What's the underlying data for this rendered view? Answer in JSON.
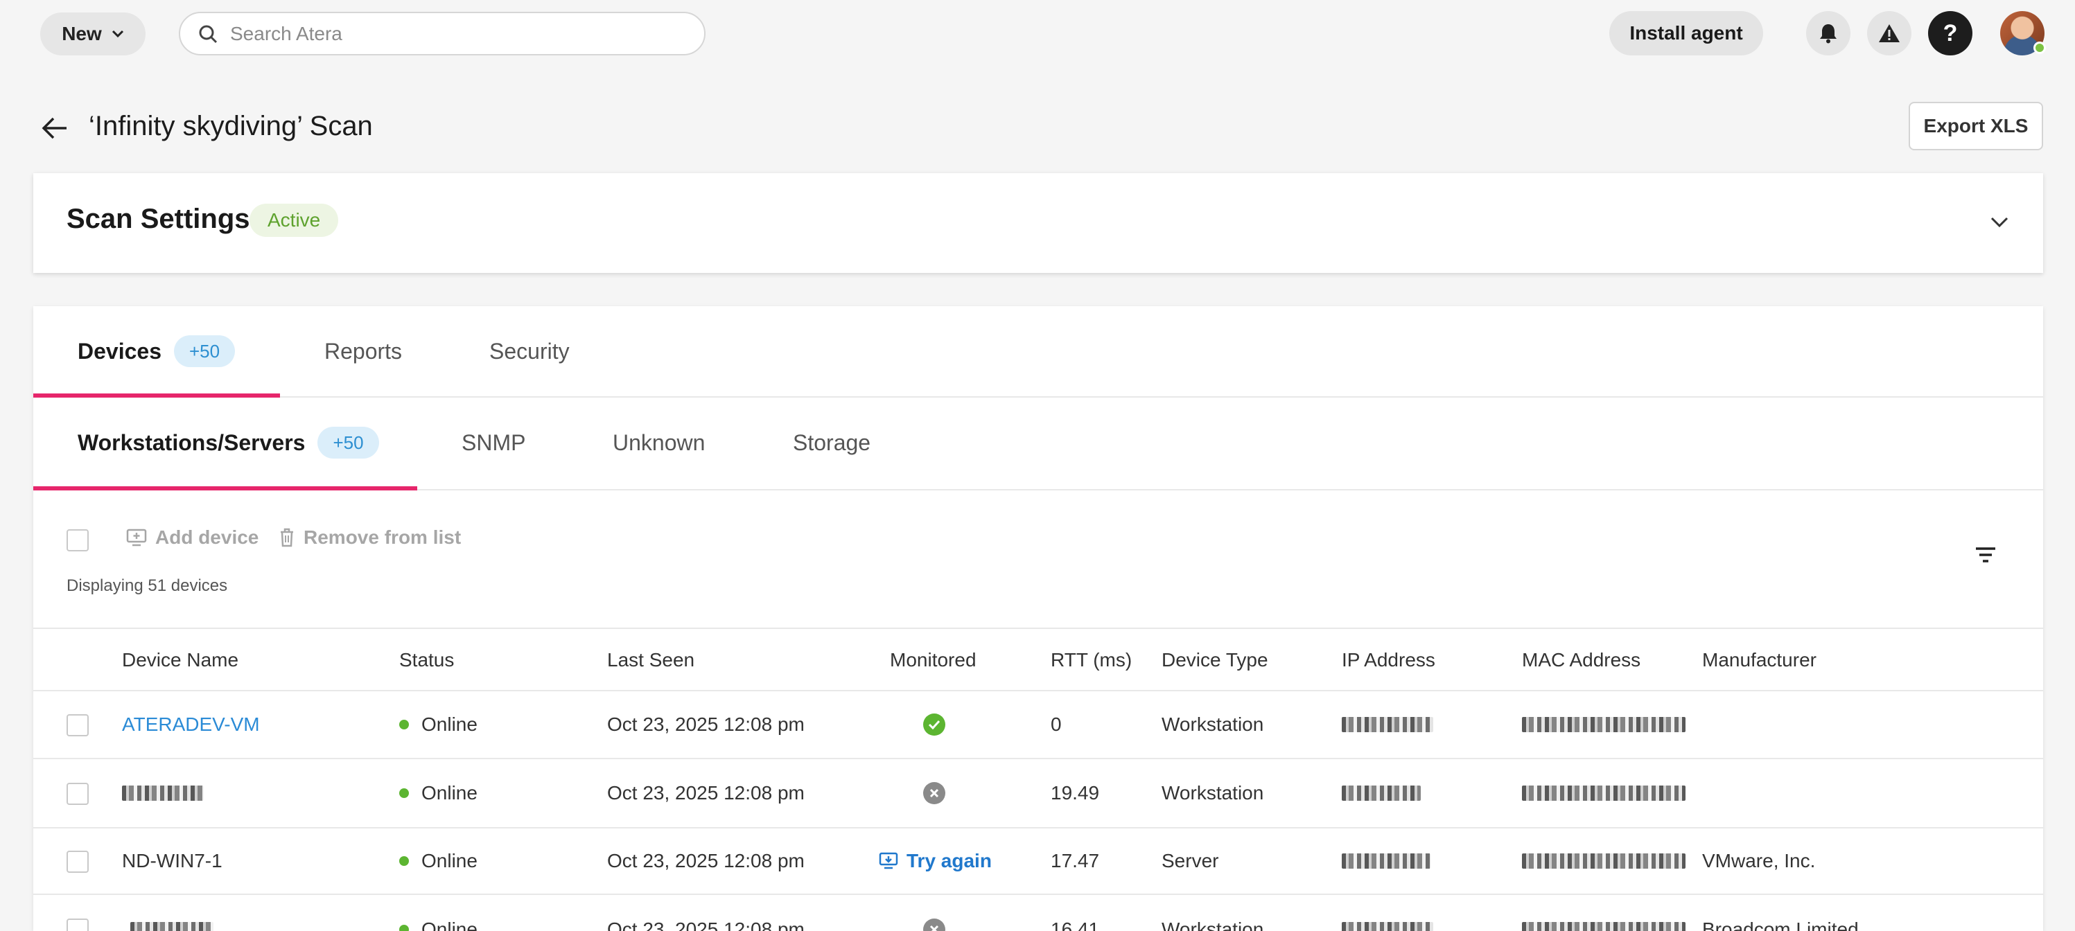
{
  "topbar": {
    "new_label": "New",
    "search_placeholder": "Search Atera",
    "install_agent_label": "Install agent",
    "help_label": "?"
  },
  "header": {
    "title": "‘Infinity skydiving’ Scan",
    "export_label": "Export XLS"
  },
  "settings": {
    "title": "Scan Settings",
    "status_badge": "Active"
  },
  "tabs": [
    {
      "label": "Devices",
      "badge": "+50"
    },
    {
      "label": "Reports"
    },
    {
      "label": "Security"
    }
  ],
  "subtabs": [
    {
      "label": "Workstations/Servers",
      "badge": "+50"
    },
    {
      "label": "SNMP"
    },
    {
      "label": "Unknown"
    },
    {
      "label": "Storage"
    }
  ],
  "toolbar": {
    "add_device_label": "Add device",
    "remove_label": "Remove from list",
    "displaying": "Displaying 51 devices"
  },
  "table": {
    "columns": [
      "Device Name",
      "Status",
      "Last Seen",
      "Monitored",
      "RTT (ms)",
      "Device Type",
      "IP Address",
      "MAC Address",
      "Manufacturer"
    ],
    "rows": [
      {
        "name": "ATERADEV-VM",
        "name_obscured": false,
        "status": "Online",
        "last_seen": "Oct 23, 2025 12:08 pm",
        "monitored": "yes",
        "rtt": "0",
        "type": "Workstation",
        "manufacturer": ""
      },
      {
        "name": "",
        "name_obscured": true,
        "status": "Online",
        "last_seen": "Oct 23, 2025 12:08 pm",
        "monitored": "no",
        "rtt": "19.49",
        "type": "Workstation",
        "manufacturer": ""
      },
      {
        "name": "ND-WIN7-1",
        "name_obscured": false,
        "status": "Online",
        "last_seen": "Oct 23, 2025 12:08 pm",
        "monitored": "try",
        "monitored_label": "Try again",
        "rtt": "17.47",
        "type": "Server",
        "manufacturer": "VMware, Inc."
      },
      {
        "name": "",
        "name_obscured": true,
        "status": "Online",
        "last_seen": "Oct 23, 2025 12:08 pm",
        "monitored": "no",
        "rtt": "16.41",
        "type": "Workstation",
        "manufacturer": "Broadcom Limited"
      }
    ]
  },
  "colors": {
    "accent_tab": "#e6266b",
    "link": "#2b8bd6",
    "online": "#5cb531",
    "active_badge_text": "#5ea22e"
  },
  "icons": [
    "chevron-down-icon",
    "search-icon",
    "bell-icon",
    "warning-icon",
    "help-icon",
    "arrow-left-icon",
    "add-device-icon",
    "trash-icon",
    "filter-icon",
    "check-circle-icon",
    "x-circle-icon",
    "monitor-icon"
  ]
}
